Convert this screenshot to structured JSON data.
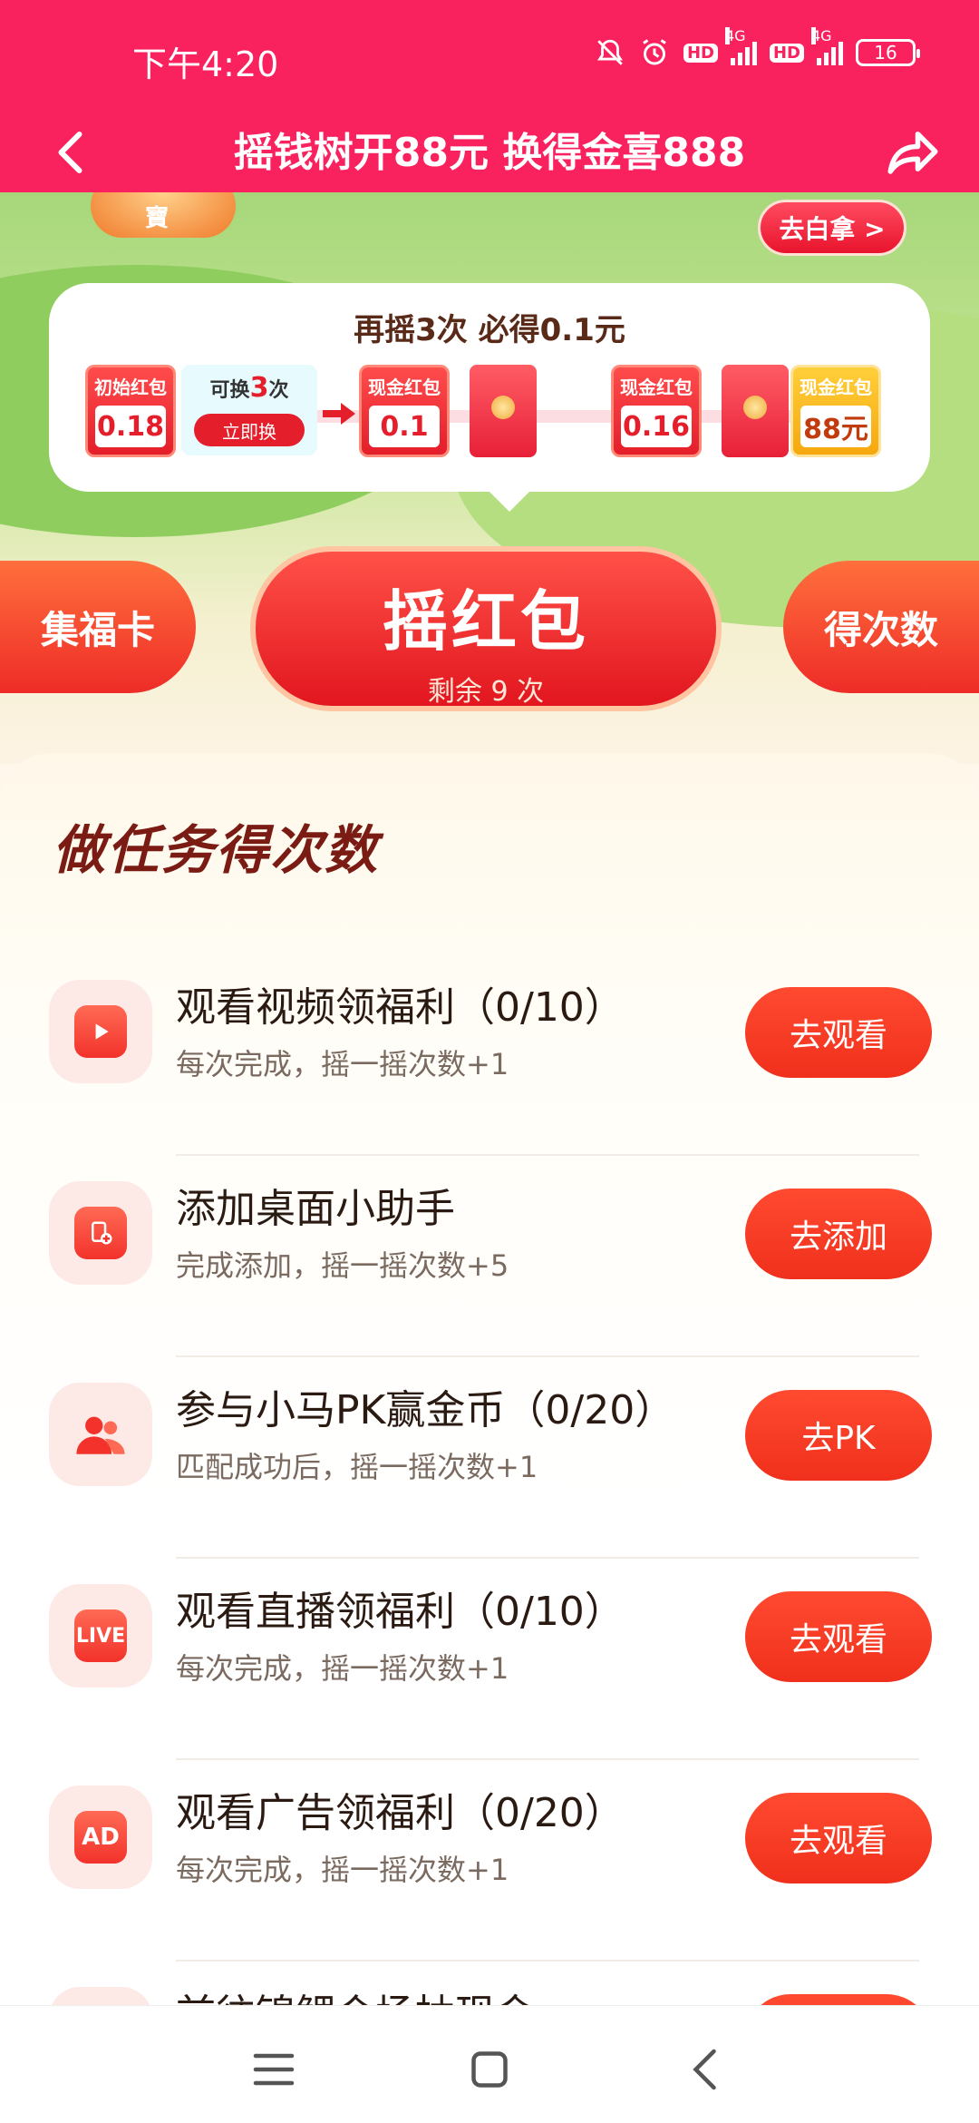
{
  "status_bar": {
    "time": "下午4:20",
    "hd_label": "HD",
    "network": "4G",
    "battery": "16"
  },
  "header": {
    "title": "摇钱树开88元 换得金喜888",
    "top_button": "去白拿 >"
  },
  "hero": {
    "pig_text": "寶"
  },
  "progress": {
    "title": "再摇3次 必得0.1元",
    "start_packet": {
      "label": "初始红包",
      "value": "0.18"
    },
    "exchange": {
      "prefix": "可换",
      "count": "3",
      "suffix": "次",
      "button": "立即换"
    },
    "packets": [
      {
        "label": "现金红包",
        "value": "0.1"
      },
      {
        "label": "现金红包",
        "value": "0.16"
      },
      {
        "label": "现金红包",
        "value": "88元"
      }
    ]
  },
  "actions": {
    "left": "集福卡",
    "center": "摇红包",
    "center_sub": "剩余 9 次",
    "right": "得次数"
  },
  "tasks_panel": {
    "title": "做任务得次数",
    "tasks": [
      {
        "name": "观看视频领福利（0/10）",
        "desc": "每次完成，摇一摇次数+1",
        "button": "去观看",
        "icon_text": ""
      },
      {
        "name": "添加桌面小助手",
        "desc": "完成添加，摇一摇次数+5",
        "button": "去添加",
        "icon_text": ""
      },
      {
        "name": "参与小马PK赢金币（0/20）",
        "desc": "匹配成功后，摇一摇次数+1",
        "button": "去PK",
        "icon_text": ""
      },
      {
        "name": "观看直播领福利（0/10）",
        "desc": "每次完成，摇一摇次数+1",
        "button": "去观看",
        "icon_text": "LIVE"
      },
      {
        "name": "观看广告领福利（0/20）",
        "desc": "每次完成，摇一摇次数+1",
        "button": "去观看",
        "icon_text": "AD"
      },
      {
        "name": "前往锦鲤会场抽现金",
        "desc": "",
        "button": "",
        "icon_text": ""
      }
    ]
  },
  "colors": {
    "brand": "#f9215e",
    "accent": "#f0301c",
    "title_dark": "#7a1b14"
  }
}
